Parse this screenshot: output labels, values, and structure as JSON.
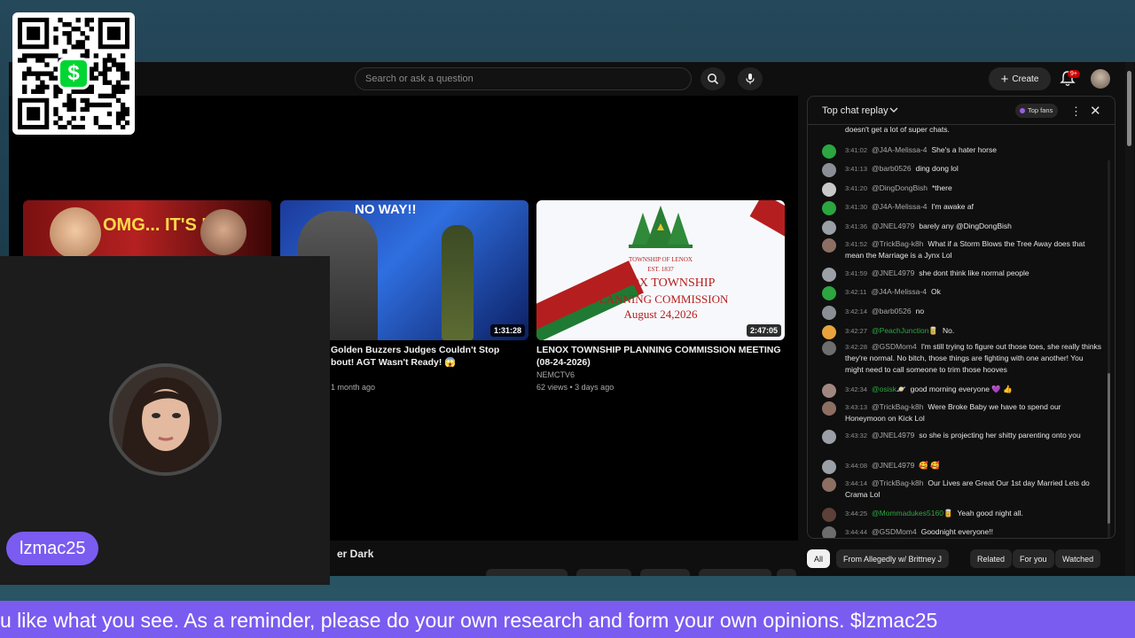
{
  "overlay": {
    "qr_icon": "cash-app-qr-code",
    "cash_symbol": "$",
    "streamer_name": "lzmac25",
    "ticker_text": "u like what you see. As a reminder, please do your own research and form your own opinions. $lzmac25",
    "accent_color": "#7a5cf0"
  },
  "header": {
    "search_placeholder": "Search or ask a question",
    "create_label": "Create",
    "notification_count": "9+"
  },
  "videos": [
    {
      "thumb_text": "OMG... IT'S HIM!",
      "corner_text": "",
      "duration": "",
      "title_line1": "",
      "title_line2": "",
      "channel": "",
      "meta": ""
    },
    {
      "thumb_text": "NO WAY!!",
      "duration": "1:31:28",
      "title_line1": "Golden Buzzers Judges Couldn't Stop",
      "title_line2": "bout! AGT Wasn't Ready! 😱",
      "meta": "1 month ago"
    },
    {
      "thumb_line1": "TOWNSHIP OF LENOX",
      "thumb_line2": "EST. 1837",
      "thumb_line3": "LENOX TOWNSHIP",
      "thumb_line4": "PLANNING COMMISSION",
      "thumb_line5": "August 24,2026",
      "duration": "2:47:05",
      "title_line1": "LENOX TOWNSHIP PLANNING COMMISSION MEETING",
      "title_line2": "(08-24-2026)",
      "channel": "NEMCTV6",
      "meta": "62 views • 3 days ago"
    }
  ],
  "below_video_title": "er Dark",
  "chat": {
    "title": "Top chat replay",
    "top_fans_label": "Top fans",
    "overflow_text": "doesn't get a lot of super chats.",
    "messages": [
      {
        "time": "3:41:02",
        "author": "@J4A-Melissa-4",
        "text": "She's a hater horse",
        "avatar_color": "#2ba640",
        "author_green": false
      },
      {
        "time": "3:41:13",
        "author": "@barb0526",
        "text": "ding dong lol",
        "avatar_color": "#8a8f96",
        "author_green": false
      },
      {
        "time": "3:41:20",
        "author": "@DingDongBish",
        "text": "*there",
        "avatar_color": "#c9c9c9",
        "author_green": false
      },
      {
        "time": "3:41:30",
        "author": "@J4A-Melissa-4",
        "text": "I'm awake af",
        "avatar_color": "#2ba640",
        "author_green": false
      },
      {
        "time": "3:41:36",
        "author": "@JNEL4979",
        "text": "barely any @DingDongBish",
        "avatar_color": "#9aa0a6",
        "author_green": false
      },
      {
        "time": "3:41:52",
        "author": "@TrickBag-k8h",
        "text": "What if a Storm Blows the Tree Away does that mean the Marriage is a Jynx Lol",
        "avatar_color": "#8d6e63",
        "author_green": false
      },
      {
        "time": "3:41:59",
        "author": "@JNEL4979",
        "text": "she dont think like normal people",
        "avatar_color": "#9aa0a6",
        "author_green": false
      },
      {
        "time": "3:42:11",
        "author": "@J4A-Melissa-4",
        "text": "Ok",
        "avatar_color": "#2ba640",
        "author_green": false
      },
      {
        "time": "3:42:14",
        "author": "@barb0526",
        "text": "no",
        "avatar_color": "#8a8f96",
        "author_green": false
      },
      {
        "time": "3:42:27",
        "author": "@PeachJunction🥫",
        "text": "No.",
        "avatar_color": "#e8a33c",
        "author_green": true
      },
      {
        "time": "3:42:28",
        "author": "@GSDMom4",
        "text": "I'm still trying to figure out those toes, she really thinks they're normal. No bitch, those things are fighting with one another! You might need to call someone to trim those hooves",
        "avatar_color": "#6d6d6d",
        "author_green": false
      },
      {
        "time": "3:42:34",
        "author": "@osisk🪐",
        "text": "good morning everyone 💜 👍",
        "avatar_color": "#a1887f",
        "author_green": true
      },
      {
        "time": "3:43:13",
        "author": "@TrickBag-k8h",
        "text": "Were Broke Baby we have to spend our Honeymoon on Kick Lol",
        "avatar_color": "#8d6e63",
        "author_green": false
      },
      {
        "time": "3:43:32",
        "author": "@JNEL4979",
        "text": "so she is projecting her shitty parenting onto you",
        "avatar_color": "#9aa0a6",
        "author_green": false
      },
      {
        "time": "3:44:08",
        "author": "@JNEL4979",
        "text": "🥰 🥰",
        "avatar_color": "#9aa0a6",
        "author_green": false
      },
      {
        "time": "3:44:14",
        "author": "@TrickBag-k8h",
        "text": "Our Lives are Great Our 1st day Married Lets do Crama Lol",
        "avatar_color": "#8d6e63",
        "author_green": false
      },
      {
        "time": "3:44:25",
        "author": "@Mommadukes5160🥫",
        "text": "Yeah good night all.",
        "avatar_color": "#5d4037",
        "author_green": true
      },
      {
        "time": "3:44:44",
        "author": "@GSDMom4",
        "text": "Goodnight everyone!!",
        "avatar_color": "#6d6d6d",
        "author_green": false
      }
    ]
  },
  "chips": [
    {
      "label": "All",
      "active": true
    },
    {
      "label": "From Allegedly w/ Brittney J",
      "active": false
    },
    {
      "label": "Related",
      "active": false
    },
    {
      "label": "For you",
      "active": false
    },
    {
      "label": "Watched",
      "active": false
    }
  ]
}
